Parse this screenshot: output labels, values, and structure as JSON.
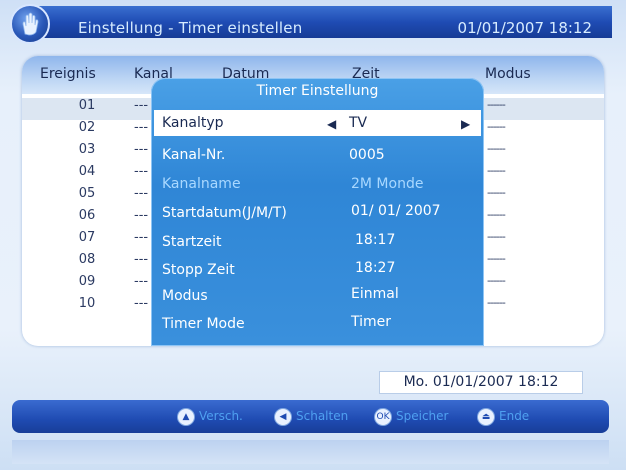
{
  "header": {
    "title": "Einstellung - Timer einstellen",
    "datetime": "01/01/2007  18:12"
  },
  "table": {
    "columns": [
      "Ereignis",
      "Kanal",
      "Datum",
      "Zeit",
      "Modus"
    ],
    "rows": [
      {
        "num": "01",
        "dash": "---",
        "modus": "------"
      },
      {
        "num": "02",
        "dash": "---",
        "modus": "------"
      },
      {
        "num": "03",
        "dash": "---",
        "modus": "------"
      },
      {
        "num": "04",
        "dash": "---",
        "modus": "------"
      },
      {
        "num": "05",
        "dash": "---",
        "modus": "------"
      },
      {
        "num": "06",
        "dash": "---",
        "modus": "------"
      },
      {
        "num": "07",
        "dash": "---",
        "modus": "------"
      },
      {
        "num": "08",
        "dash": "---",
        "modus": "------"
      },
      {
        "num": "09",
        "dash": "---",
        "modus": "------"
      },
      {
        "num": "10",
        "dash": "---",
        "modus": "------"
      }
    ],
    "selected_row": "01"
  },
  "dialog": {
    "title": "Timer Einstellung",
    "fields": [
      {
        "label": "Kanaltyp",
        "value": "TV"
      },
      {
        "label": "Kanal-Nr.",
        "value": "0005"
      },
      {
        "label": "Kanalname",
        "value": "2M Monde"
      },
      {
        "label": "Startdatum(J/M/T)",
        "value": "01/ 01/ 2007"
      },
      {
        "label": "Startzeit",
        "value": "18:17"
      },
      {
        "label": "Stopp Zeit",
        "value": "18:27"
      },
      {
        "label": "Modus",
        "value": "Einmal"
      },
      {
        "label": "Timer Mode",
        "value": "Timer"
      }
    ]
  },
  "status": {
    "current_date": "Mo. 01/01/2007 18:12"
  },
  "help": {
    "items": [
      {
        "icon": "up-down-arrows-icon",
        "label": "Versch."
      },
      {
        "icon": "left-right-arrows-icon",
        "label": "Schalten"
      },
      {
        "icon": "ok-icon",
        "glyph": "OK",
        "label": "Speicher"
      },
      {
        "icon": "exit-icon",
        "label": "Ende"
      }
    ]
  },
  "colors": {
    "titlebar": "#1f4cb4",
    "dialog": "#2f86d6",
    "highlight_text": "#1a2a52"
  }
}
